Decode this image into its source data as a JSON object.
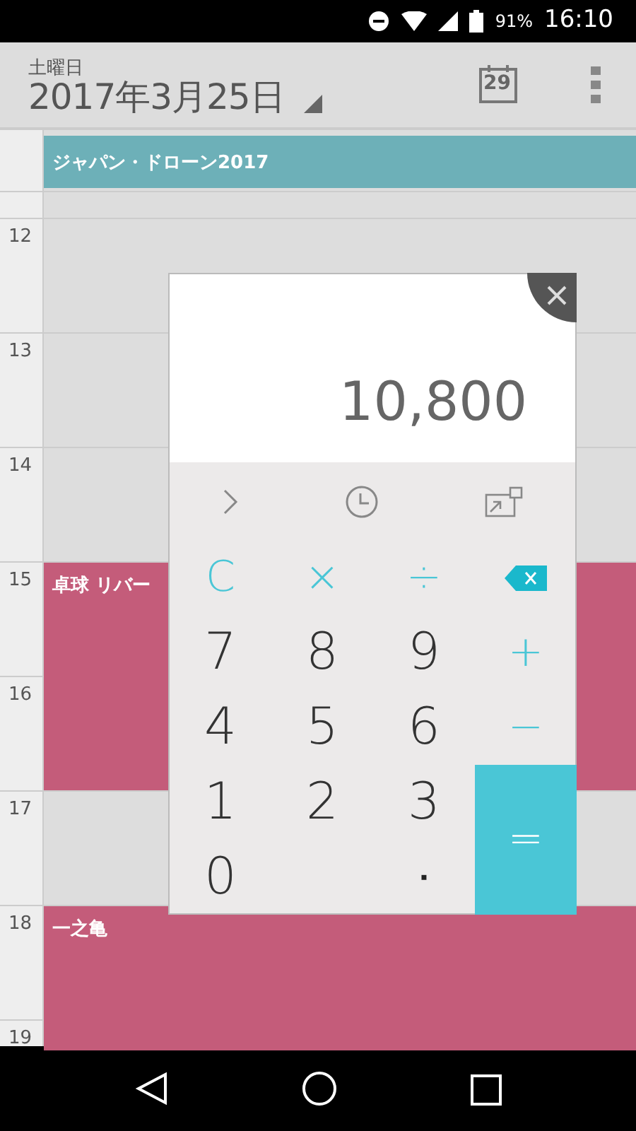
{
  "status_bar": {
    "battery": "91%",
    "time": "16:10"
  },
  "header": {
    "weekday": "土曜日",
    "date": "2017年3月25日",
    "today_day": "29"
  },
  "all_day_events": [
    {
      "title": "ジャパン・ドローン2017",
      "color": "#6db0b8"
    }
  ],
  "hours": [
    {
      "label": "12"
    },
    {
      "label": "13"
    },
    {
      "label": "14"
    },
    {
      "label": "15",
      "event": {
        "title": "卓球 リバー",
        "color": "#c45c7a",
        "spans_next_hour": true
      }
    },
    {
      "label": "16"
    },
    {
      "label": "17"
    },
    {
      "label": "18",
      "event": {
        "title": "一之亀",
        "color": "#c45c7a",
        "spans_next_hour": true
      }
    },
    {
      "label": "19"
    }
  ],
  "calculator": {
    "display": "10,800",
    "keys": [
      {
        "kind": "func",
        "label": "C"
      },
      {
        "kind": "func",
        "label": "×"
      },
      {
        "kind": "func",
        "label": "÷"
      },
      {
        "kind": "backspace"
      },
      {
        "kind": "digit",
        "label": "7"
      },
      {
        "kind": "digit",
        "label": "8"
      },
      {
        "kind": "digit",
        "label": "9"
      },
      {
        "kind": "func",
        "label": "+"
      },
      {
        "kind": "digit",
        "label": "4"
      },
      {
        "kind": "digit",
        "label": "5"
      },
      {
        "kind": "digit",
        "label": "6"
      },
      {
        "kind": "func",
        "label": "−"
      },
      {
        "kind": "digit",
        "label": "1"
      },
      {
        "kind": "digit",
        "label": "2"
      },
      {
        "kind": "digit",
        "label": "3"
      },
      {
        "kind": "equals",
        "label": "="
      },
      {
        "kind": "digit",
        "label": "0"
      },
      {
        "kind": "blank"
      },
      {
        "kind": "point",
        "label": "▪"
      }
    ]
  }
}
